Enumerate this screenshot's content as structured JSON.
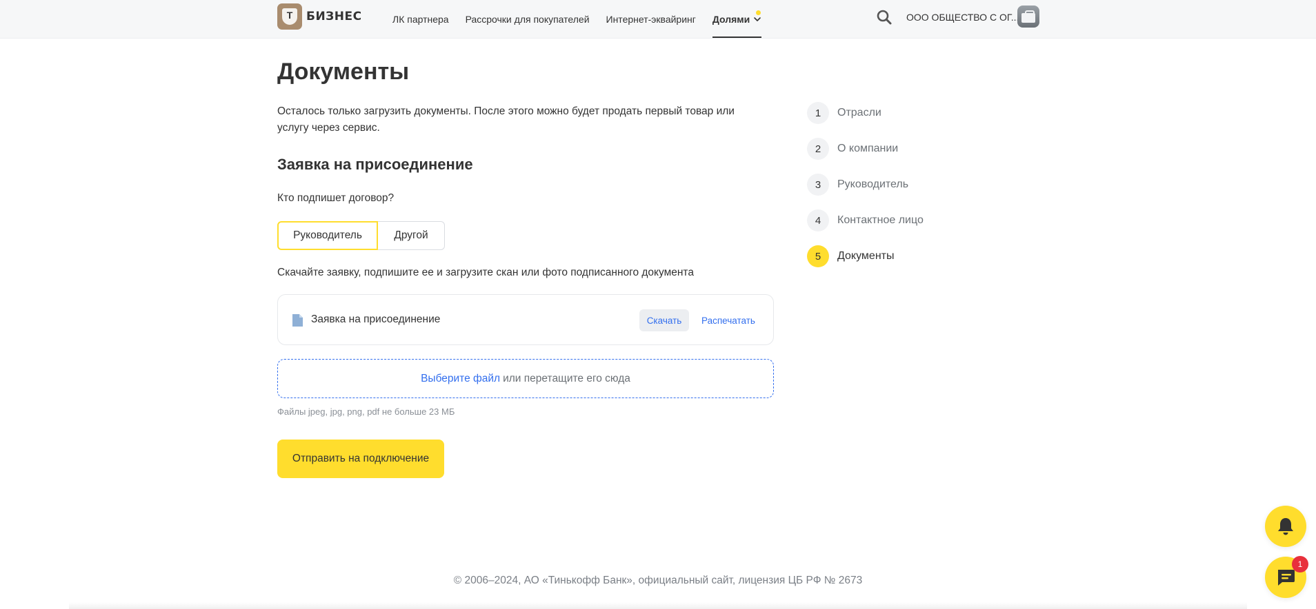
{
  "header": {
    "logo_text": "БИЗНЕС",
    "logo_letter": "Т",
    "nav": [
      {
        "label": "ЛК партнера"
      },
      {
        "label": "Рассрочки для покупателей"
      },
      {
        "label": "Интернет-эквайринг"
      },
      {
        "label": "Долями",
        "active": true
      }
    ],
    "org_name": "ООО ОБЩЕСТВО С ОГ..."
  },
  "main": {
    "title": "Документы",
    "intro": "Осталось только загрузить документы. После этого можно будет продать первый товар или услугу через сервис.",
    "section_title": "Заявка на присоединение",
    "who_label": "Кто подпишет договор?",
    "signer_options": [
      "Руководитель",
      "Другой"
    ],
    "signer_selected": "Руководитель",
    "instruction": "Скачайте заявку, подпишите ее и загрузите скан или фото подписанного документа",
    "document": {
      "name": "Заявка на присоединение",
      "download_label": "Скачать",
      "print_label": "Распечатать"
    },
    "dropzone": {
      "link_text": "Выберите файл",
      "rest_text": "или перетащите его сюда"
    },
    "file_hint": "Файлы jpeg, jpg, png, pdf не больше 23 МБ",
    "submit_label": "Отправить на подключение"
  },
  "steps": [
    {
      "num": "1",
      "label": "Отрасли"
    },
    {
      "num": "2",
      "label": "О компании"
    },
    {
      "num": "3",
      "label": "Руководитель"
    },
    {
      "num": "4",
      "label": "Контактное лицо"
    },
    {
      "num": "5",
      "label": "Документы",
      "current": true
    }
  ],
  "footer": "© 2006–2024, АО «Тинькофф Банк», официальный сайт, лицензия ЦБ РФ № 2673",
  "chat_badge": "1",
  "colors": {
    "accent_yellow": "#ffdd2d",
    "link_blue": "#336fee",
    "badge_red": "#e8303c",
    "header_bg": "#f6f7f8"
  },
  "icons": {
    "search": "search-icon",
    "bell": "bell-icon",
    "chat": "chat-icon",
    "document": "document-icon",
    "chevron": "chevron-down-icon"
  }
}
